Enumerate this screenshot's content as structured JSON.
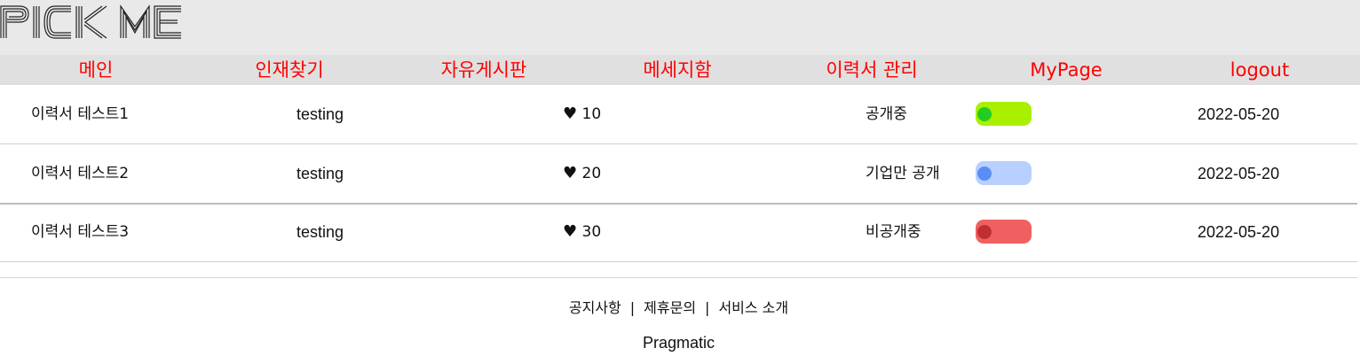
{
  "logo": {
    "text": "PICK ME"
  },
  "nav": {
    "items": [
      {
        "label": "메인"
      },
      {
        "label": "인재찾기"
      },
      {
        "label": "자유게시판"
      },
      {
        "label": "메세지함"
      },
      {
        "label": "이력서 관리"
      },
      {
        "label": "MyPage"
      },
      {
        "label": "logout"
      }
    ],
    "color": "#ff0000"
  },
  "resumes": [
    {
      "title": "이력서 테스트1",
      "author": "testing",
      "likes": "10",
      "status": "공개중",
      "toggle_color": "#a8f000",
      "knob_color": "#22cc22",
      "date": "2022-05-20"
    },
    {
      "title": "이력서 테스트2",
      "author": "testing",
      "likes": "20",
      "status": "기업만 공개",
      "toggle_color": "#b7d0ff",
      "knob_color": "#5a8df5",
      "date": "2022-05-20"
    },
    {
      "title": "이력서 테스트3",
      "author": "testing",
      "likes": "30",
      "status": "비공개중",
      "toggle_color": "#f06060",
      "knob_color": "#c03030",
      "date": "2022-05-20"
    }
  ],
  "icons": {
    "like": "heart-icon"
  },
  "footer": {
    "links": [
      "공지사항",
      "제휴문의",
      "서비스 소개"
    ],
    "separator": "|",
    "brand": "Pragmatic"
  }
}
